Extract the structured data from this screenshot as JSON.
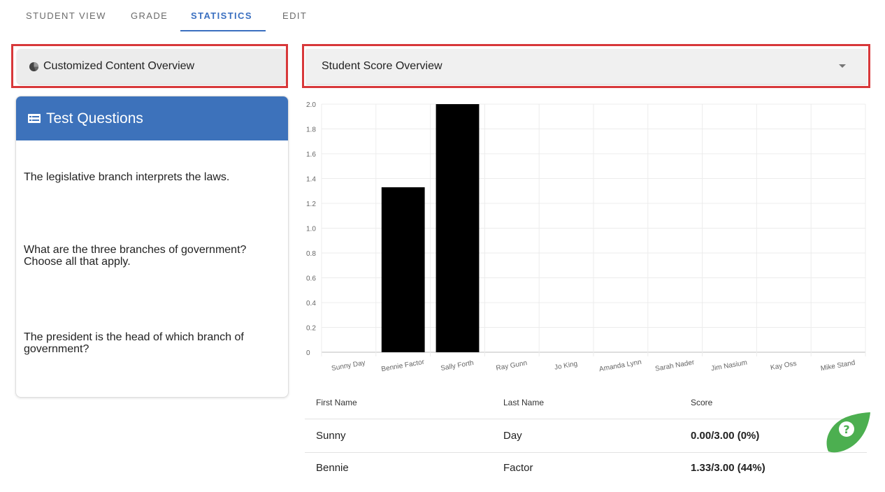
{
  "tabs": [
    {
      "label": "STUDENT VIEW",
      "active": false
    },
    {
      "label": "GRADE",
      "active": false
    },
    {
      "label": "STATISTICS",
      "active": true
    },
    {
      "label": "EDIT",
      "active": false
    }
  ],
  "overview_button": {
    "label": "Customized Content Overview",
    "icon": "pie-chart-icon"
  },
  "score_dropdown": {
    "selected": "Student Score Overview",
    "icon": "caret-down-icon"
  },
  "questions_card": {
    "title": "Test Questions",
    "icon": "list-card-icon",
    "questions": [
      "The legislative branch interprets the laws.",
      "What are the three branches of government? Choose all that apply.",
      "The president is the head of which branch of government?"
    ]
  },
  "chart_data": {
    "type": "bar",
    "categories": [
      "Sunny Day",
      "Bennie Factor",
      "Sally Forth",
      "Ray Gunn",
      "Jo King",
      "Amanda Lynn",
      "Sarah Nader",
      "Jim Nasium",
      "Kay Oss",
      "Mike Stand"
    ],
    "values": [
      0,
      1.33,
      2.0,
      0,
      0,
      0,
      0,
      0,
      0,
      0
    ],
    "yticks": [
      "0",
      "0.2",
      "0.4",
      "0.6",
      "0.8",
      "1.0",
      "1.2",
      "1.4",
      "1.6",
      "1.8",
      "2.0"
    ],
    "ylim": [
      0,
      2.0
    ],
    "grid": true,
    "bar_color": "#000000"
  },
  "score_table": {
    "headers": [
      "First Name",
      "Last Name",
      "Score"
    ],
    "rows": [
      [
        "Sunny",
        "Day",
        "0.00/3.00 (0%)"
      ],
      [
        "Bennie",
        "Factor",
        "1.33/3.00 (44%)"
      ]
    ]
  },
  "colors": {
    "accent": "#3a6fc0",
    "card_header": "#3d72bb",
    "highlight": "#d8383a",
    "help_button": "#4caf50"
  },
  "help_button": {
    "icon": "question-mark-icon",
    "glyph": "?"
  }
}
